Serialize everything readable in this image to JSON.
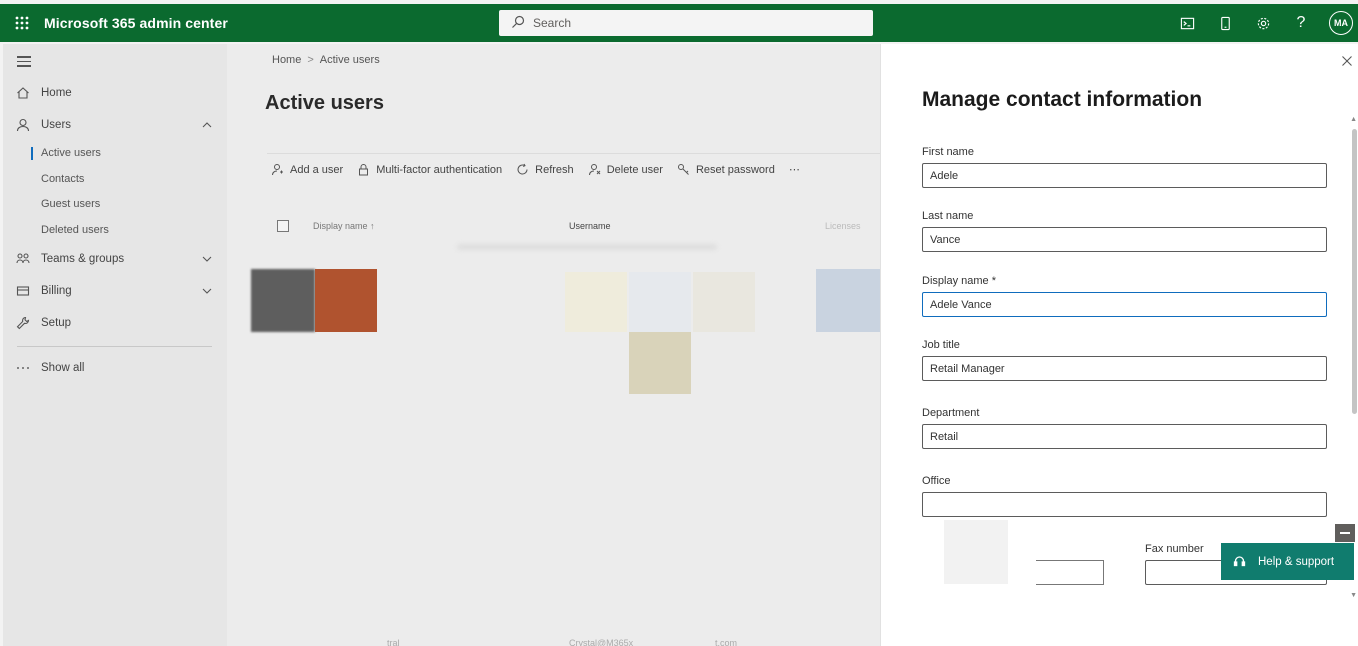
{
  "app": {
    "title": "Microsoft 365 admin center"
  },
  "topbar": {
    "search_placeholder": "Search",
    "icons": [
      "waffle-icon",
      "terminal-icon",
      "mobile-icon",
      "settings-icon",
      "help-icon"
    ],
    "help_glyph": "?",
    "avatar_initials": "MA"
  },
  "nav": {
    "items": [
      {
        "label": "Home",
        "icon": "home-icon"
      },
      {
        "label": "Users",
        "icon": "user-icon"
      },
      {
        "label": "Teams & groups",
        "icon": "teams-icon"
      },
      {
        "label": "Billing",
        "icon": "billing-icon"
      },
      {
        "label": "Setup",
        "icon": "wrench-icon"
      },
      {
        "label": "Show all",
        "icon": "more-icon"
      }
    ],
    "users_sub": [
      "Active users",
      "Contacts",
      "Guest users",
      "Deleted users"
    ]
  },
  "main": {
    "breadcrumb": [
      "Home",
      "Active users"
    ],
    "title": "Active users",
    "toolbar": [
      "Add a user",
      "Multi-factor authentication",
      "Refresh",
      "Delete user",
      "Reset password"
    ],
    "more_glyph": "⋯",
    "columns": [
      "Display name ↑",
      "Username",
      "Licenses"
    ],
    "faded_text": [
      "tral",
      "Crystal@M365x",
      "t.com"
    ]
  },
  "panel": {
    "title": "Manage contact information",
    "fields": {
      "first_name_label": "First name",
      "first_name_value": "Adele",
      "last_name_label": "Last name",
      "last_name_value": "Vance",
      "display_name_label": "Display name *",
      "display_name_value": "Adele Vance",
      "job_title_label": "Job title",
      "job_title_value": "Retail Manager",
      "department_label": "Department",
      "department_value": "Retail",
      "office_label": "Office",
      "office_value": "",
      "fax_label": "Fax number",
      "fax_value": ""
    }
  },
  "help": {
    "label": "Help & support"
  },
  "colors": {
    "topbar": "#0b6a2f",
    "accent": "#0f6cbd",
    "help": "#107c6e"
  }
}
